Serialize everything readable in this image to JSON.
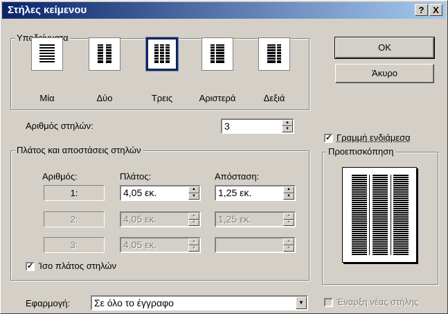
{
  "window": {
    "title": "Στήλες κείμενου",
    "help_button": "?",
    "close_button": "X"
  },
  "presets": {
    "legend": "Υποδείγματα",
    "items": [
      {
        "label": "Μία",
        "icon": "one-column-icon",
        "selected": false
      },
      {
        "label": "Δύο",
        "icon": "two-columns-icon",
        "selected": false
      },
      {
        "label": "Τρεις",
        "icon": "three-columns-icon",
        "selected": true
      },
      {
        "label": "Αριστερά",
        "icon": "left-column-icon",
        "selected": false
      },
      {
        "label": "Δεξιά",
        "icon": "right-column-icon",
        "selected": false
      }
    ]
  },
  "buttons": {
    "ok": "OK",
    "cancel": "Άκυρο"
  },
  "column_count": {
    "label": "Αριθμός στηλών:",
    "value": "3"
  },
  "line_between": {
    "label": "Γραμμή ενδιάμεσα",
    "checked": true
  },
  "width_spacing": {
    "legend": "Πλάτος και αποστάσεις στηλών",
    "headers": {
      "number": "Αριθμός:",
      "width": "Πλάτος:",
      "spacing": "Απόσταση:"
    },
    "rows": [
      {
        "number": "1:",
        "width": "4,05 εκ.",
        "spacing": "1,25 εκ.",
        "enabled": true
      },
      {
        "number": "2:",
        "width": "4,05 εκ.",
        "spacing": "1,25 εκ.",
        "enabled": false
      },
      {
        "number": "3:",
        "width": "4,05 εκ.",
        "spacing": "",
        "enabled": false
      }
    ],
    "equal_width": {
      "label": "Ίσο πλάτος στηλών",
      "checked": true
    }
  },
  "preview": {
    "legend": "Προεπισκόπηση"
  },
  "apply_to": {
    "label": "Εφαρμογή:",
    "value": "Σε όλο το έγγραφο"
  },
  "new_column": {
    "label": "Έναρξη νέας στήλης",
    "checked": false,
    "enabled": false
  },
  "colors": {
    "title_start": "#0a246a",
    "title_end": "#a6caf0",
    "face": "#d4d0c8"
  }
}
